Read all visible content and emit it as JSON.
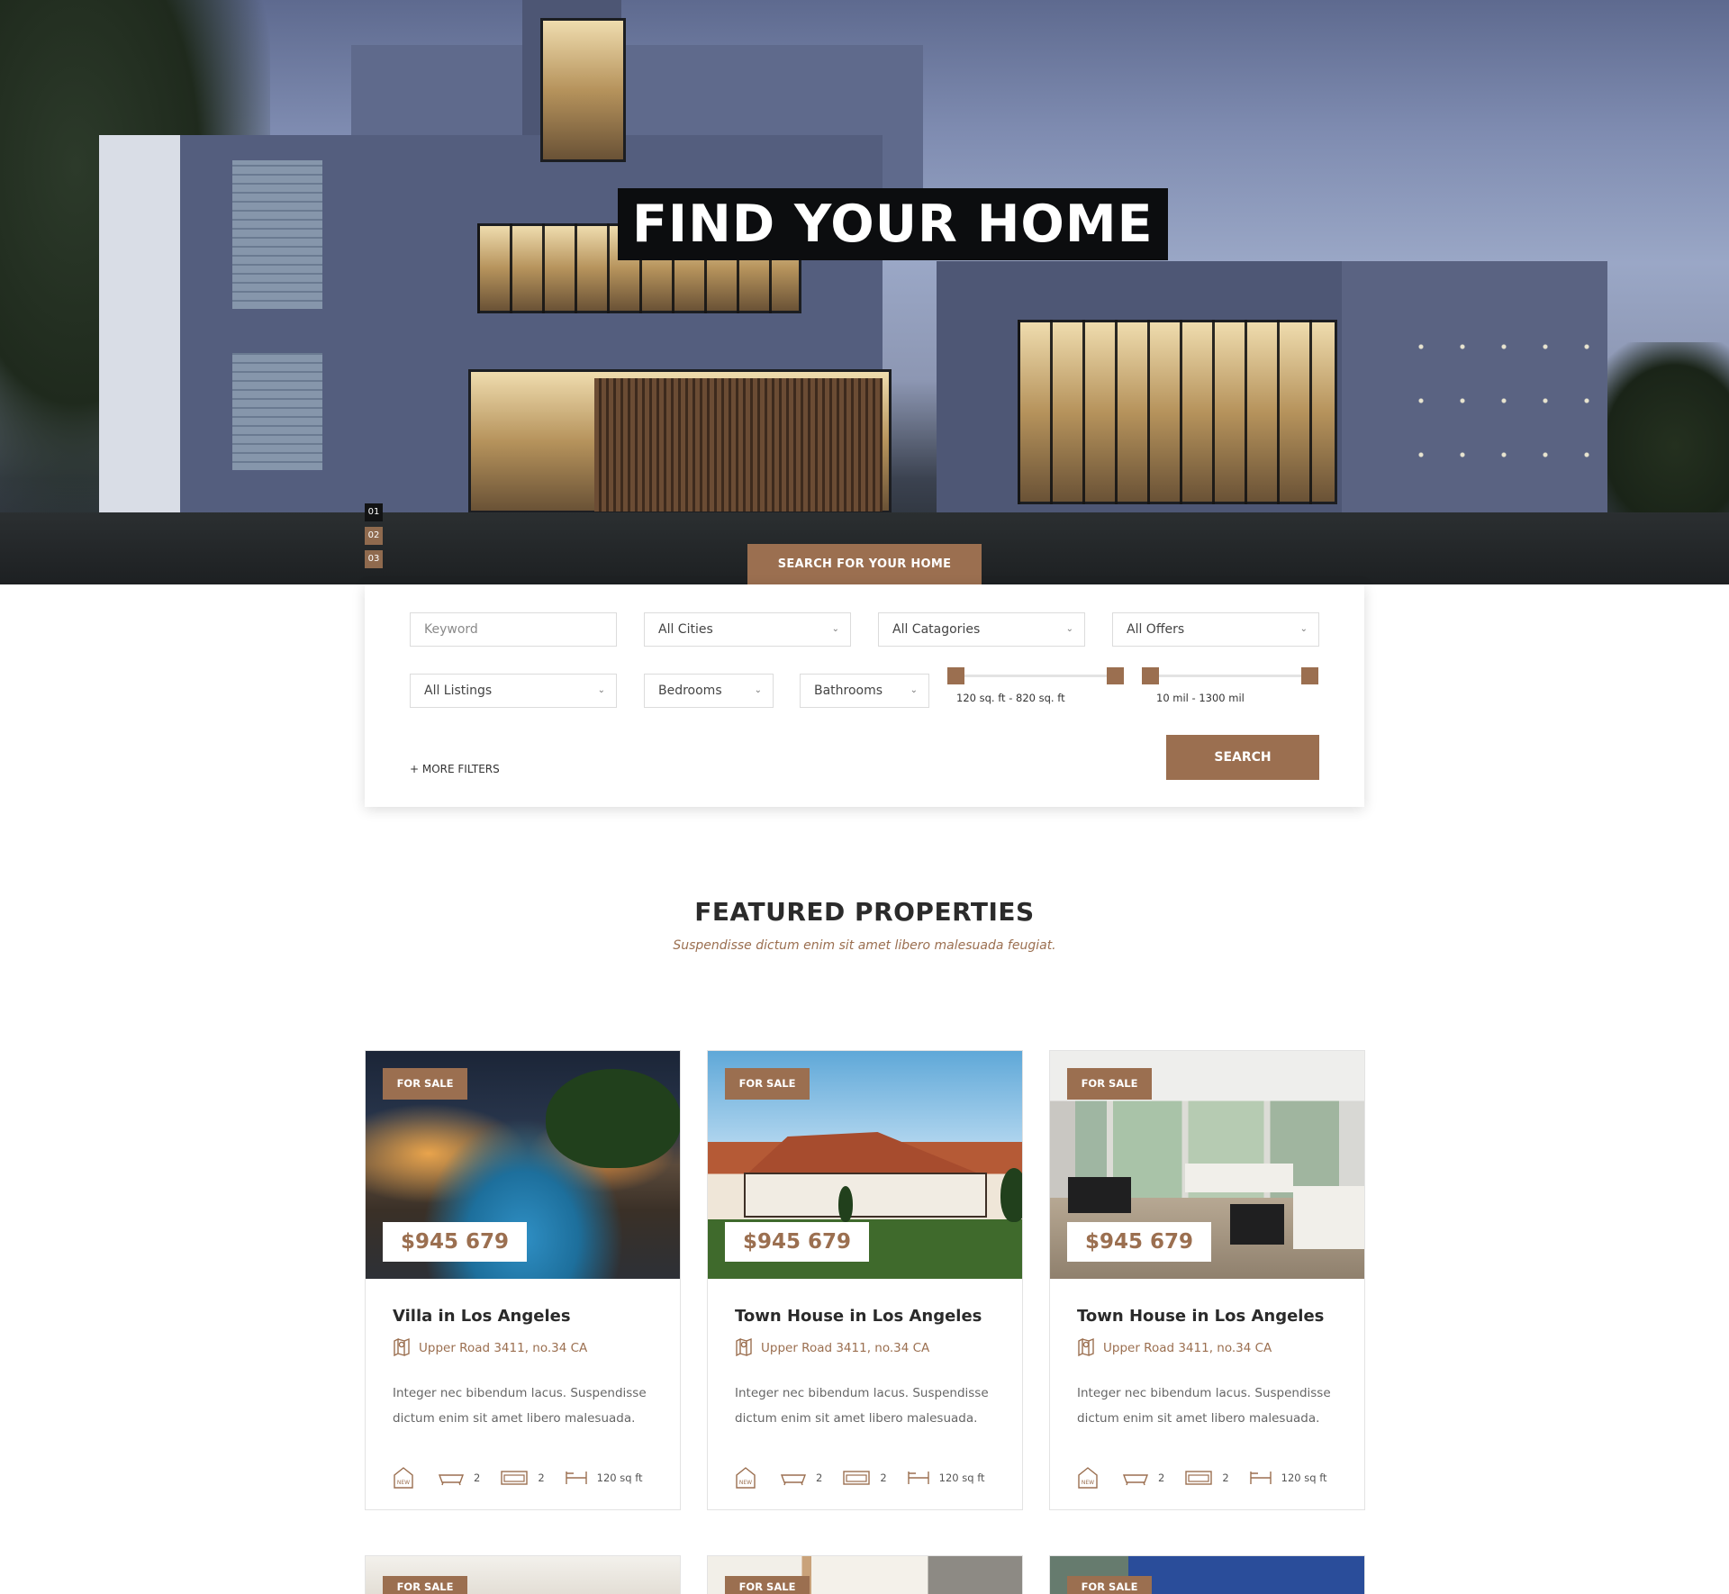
{
  "hero": {
    "title": "FIND YOUR HOME",
    "slides": [
      "01",
      "02",
      "03"
    ],
    "active_slide": "01",
    "search_tab": "SEARCH FOR YOUR HOME"
  },
  "search": {
    "keyword_placeholder": "Keyword",
    "cities": "All Cities",
    "categories": "All Catagories",
    "offers": "All Offers",
    "listings": "All Listings",
    "bedrooms": "Bedrooms",
    "bathrooms": "Bathrooms",
    "area_range": "120 sq. ft - 820 sq. ft",
    "distance_range": "10 mil - 1300 mil",
    "more_filters": "+ MORE FILTERS",
    "search_button": "SEARCH"
  },
  "featured": {
    "title": "FEATURED PROPERTIES",
    "subtitle": "Suspendisse dictum enim sit amet libero malesuada feugiat.",
    "cards": [
      {
        "badge": "FOR SALE",
        "price": "$945 679",
        "title": "Villa in Los Angeles",
        "address": "Upper Road 3411, no.34 CA",
        "description": "Integer nec bibendum lacus. Suspendisse dictum enim sit amet libero malesuada.",
        "baths": "2",
        "beds": "2",
        "area": "120 sq ft"
      },
      {
        "badge": "FOR SALE",
        "price": "$945 679",
        "title": "Town House in Los Angeles",
        "address": "Upper Road 3411, no.34 CA",
        "description": "Integer nec bibendum lacus. Suspendisse dictum enim sit amet libero malesuada.",
        "baths": "2",
        "beds": "2",
        "area": "120 sq ft"
      },
      {
        "badge": "FOR SALE",
        "price": "$945 679",
        "title": "Town House in Los Angeles",
        "address": "Upper Road 3411, no.34 CA",
        "description": "Integer nec bibendum lacus. Suspendisse dictum enim sit amet libero malesuada.",
        "baths": "2",
        "beds": "2",
        "area": "120 sq ft"
      }
    ],
    "peek_badges": [
      "FOR SALE",
      "FOR SALE",
      "FOR SALE"
    ]
  },
  "colors": {
    "accent": "#9b6f50",
    "title_bg": "#0c0d0f"
  },
  "icons": {
    "new": "new-tag-icon",
    "bath": "bathtub-icon",
    "bed": "bed-icon",
    "area": "area-icon",
    "pin": "map-pin-icon",
    "chevron": "chevron-down-icon"
  }
}
